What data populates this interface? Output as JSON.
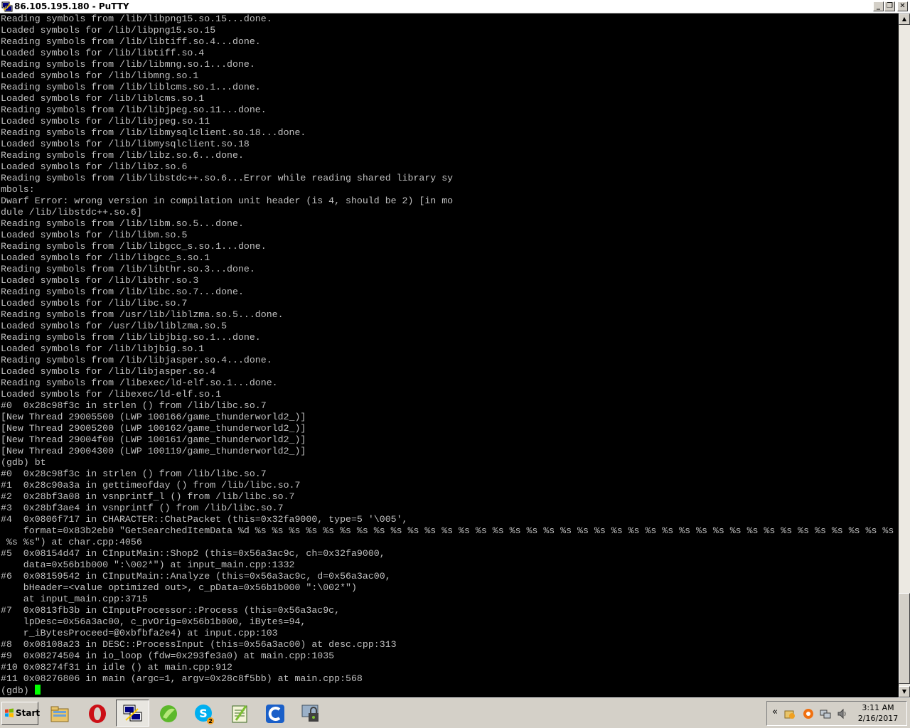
{
  "window": {
    "title": "86.105.195.180 - PuTTY",
    "minimize_glyph": "_",
    "restore_glyph": "❐",
    "close_glyph": "✕"
  },
  "terminal": {
    "lines": [
      "Reading symbols from /lib/libpng15.so.15...done.",
      "Loaded symbols for /lib/libpng15.so.15",
      "Reading symbols from /lib/libtiff.so.4...done.",
      "Loaded symbols for /lib/libtiff.so.4",
      "Reading symbols from /lib/libmng.so.1...done.",
      "Loaded symbols for /lib/libmng.so.1",
      "Reading symbols from /lib/liblcms.so.1...done.",
      "Loaded symbols for /lib/liblcms.so.1",
      "Reading symbols from /lib/libjpeg.so.11...done.",
      "Loaded symbols for /lib/libjpeg.so.11",
      "Reading symbols from /lib/libmysqlclient.so.18...done.",
      "Loaded symbols for /lib/libmysqlclient.so.18",
      "Reading symbols from /lib/libz.so.6...done.",
      "Loaded symbols for /lib/libz.so.6",
      "Reading symbols from /lib/libstdc++.so.6...Error while reading shared library sy",
      "mbols:",
      "Dwarf Error: wrong version in compilation unit header (is 4, should be 2) [in mo",
      "dule /lib/libstdc++.so.6]",
      "Reading symbols from /lib/libm.so.5...done.",
      "Loaded symbols for /lib/libm.so.5",
      "Reading symbols from /lib/libgcc_s.so.1...done.",
      "Loaded symbols for /lib/libgcc_s.so.1",
      "Reading symbols from /lib/libthr.so.3...done.",
      "Loaded symbols for /lib/libthr.so.3",
      "Reading symbols from /lib/libc.so.7...done.",
      "Loaded symbols for /lib/libc.so.7",
      "Reading symbols from /usr/lib/liblzma.so.5...done.",
      "Loaded symbols for /usr/lib/liblzma.so.5",
      "Reading symbols from /lib/libjbig.so.1...done.",
      "Loaded symbols for /lib/libjbig.so.1",
      "Reading symbols from /lib/libjasper.so.4...done.",
      "Loaded symbols for /lib/libjasper.so.4",
      "Reading symbols from /libexec/ld-elf.so.1...done.",
      "Loaded symbols for /libexec/ld-elf.so.1",
      "#0  0x28c98f3c in strlen () from /lib/libc.so.7",
      "[New Thread 29005500 (LWP 100166/game_thunderworld2_)]",
      "[New Thread 29005200 (LWP 100162/game_thunderworld2_)]",
      "[New Thread 29004f00 (LWP 100161/game_thunderworld2_)]",
      "[New Thread 29004300 (LWP 100119/game_thunderworld2_)]",
      "(gdb) bt",
      "#0  0x28c98f3c in strlen () from /lib/libc.so.7",
      "#1  0x28c90a3a in gettimeofday () from /lib/libc.so.7",
      "#2  0x28bf3a08 in vsnprintf_l () from /lib/libc.so.7",
      "#3  0x28bf3ae4 in vsnprintf () from /lib/libc.so.7",
      "#4  0x0806f717 in CHARACTER::ChatPacket (this=0x32fa9000, type=5 '\\005',",
      "    format=0x83b2eb0 \"GetSearchedItemData %d %s %s %s %s %s %s %s %s %s %s %s %s %s %s %s %s %s %s %s %s %s %s %s %s %s %s %s %s %s %s %s %s %s %s %s %s %s %s %s %s %s %s %s %s %s %s",
      " %s %s\") at char.cpp:4056",
      "#5  0x08154d47 in CInputMain::Shop2 (this=0x56a3ac9c, ch=0x32fa9000,",
      "    data=0x56b1b000 \":\\002*\") at input_main.cpp:1332",
      "#6  0x08159542 in CInputMain::Analyze (this=0x56a3ac9c, d=0x56a3ac00,",
      "    bHeader=<value optimized out>, c_pData=0x56b1b000 \":\\002*\")",
      "    at input_main.cpp:3715",
      "#7  0x0813fb3b in CInputProcessor::Process (this=0x56a3ac9c,",
      "    lpDesc=0x56a3ac00, c_pvOrig=0x56b1b000, iBytes=94,",
      "    r_iBytesProceed=@0xbfbfa2e4) at input.cpp:103",
      "#8  0x08108a23 in DESC::ProcessInput (this=0x56a3ac00) at desc.cpp:313",
      "#9  0x08274504 in io_loop (fdw=0x293fe3a0) at main.cpp:1035",
      "#10 0x08274f31 in idle () at main.cpp:912",
      "#11 0x08276806 in main (argc=1, argv=0x28c8f5bb) at main.cpp:568"
    ],
    "prompt": "(gdb) ",
    "text_color": "#c0c0c0",
    "background": "#000000",
    "cursor_color": "#00ff00"
  },
  "scrollbar": {
    "up_glyph": "▲",
    "down_glyph": "▼"
  },
  "taskbar": {
    "start_label": "Start",
    "items": [
      {
        "icon": "file-explorer-icon"
      },
      {
        "icon": "opera-icon"
      },
      {
        "icon": "putty-icon",
        "active": true
      },
      {
        "icon": "green-leaf-icon"
      },
      {
        "icon": "skype-icon",
        "badge": "2"
      },
      {
        "icon": "notepad-plus-plus-icon"
      },
      {
        "icon": "ccleaner-icon"
      },
      {
        "icon": "security-lock-icon"
      }
    ],
    "tray": {
      "chevron": "«",
      "time": "3:11 AM",
      "date": "2/16/2017",
      "icons": [
        "show-hidden-icons-icon",
        "tray-badge-icon",
        "avast-icon",
        "network-icon",
        "volume-icon"
      ]
    }
  }
}
